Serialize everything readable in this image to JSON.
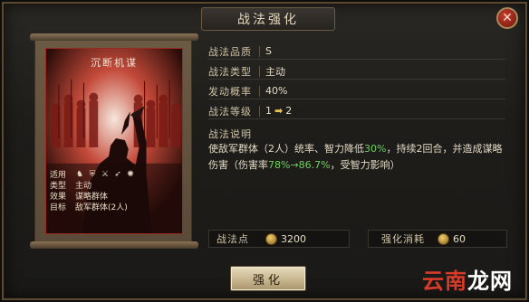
{
  "window": {
    "title": "战法强化"
  },
  "card": {
    "name": "沉断机谋",
    "info": [
      {
        "key": "适用",
        "value": ""
      },
      {
        "key": "类型",
        "value": "主动"
      },
      {
        "key": "效果",
        "value": "谋略群体"
      },
      {
        "key": "目标",
        "value": "敌军群体(2人)"
      }
    ],
    "troop_icons": [
      "cavalry-icon",
      "shield-icon",
      "spear-icon",
      "bow-icon",
      "siege-icon"
    ]
  },
  "stats": {
    "quality_label": "战法品质",
    "quality_value": "S",
    "type_label": "战法类型",
    "type_value": "主动",
    "chance_label": "发动概率",
    "chance_value": "40%",
    "level_label": "战法等级",
    "level_from": "1",
    "level_to": "2"
  },
  "description": {
    "title": "战法说明",
    "part1": "使敌军群体（2人）统率、智力降低",
    "pct1": "30%",
    "part2": "，持续2回合，并造成谋略伤害（伤害率",
    "pct2_from": "78%",
    "arrow": "→",
    "pct2_to": "86.7%",
    "part3": "，受智力影响）"
  },
  "costs": {
    "points_label": "战法点",
    "points_value": "3200",
    "consume_label": "强化消耗",
    "consume_value": "60"
  },
  "buttons": {
    "close": "✕",
    "enhance": "强化"
  },
  "watermark": {
    "part1": "云南",
    "part2": "龙网"
  },
  "colors": {
    "accent_green": "#6dd05a",
    "arrow_gold": "#e9c35a",
    "card_red": "#9a2a20"
  }
}
